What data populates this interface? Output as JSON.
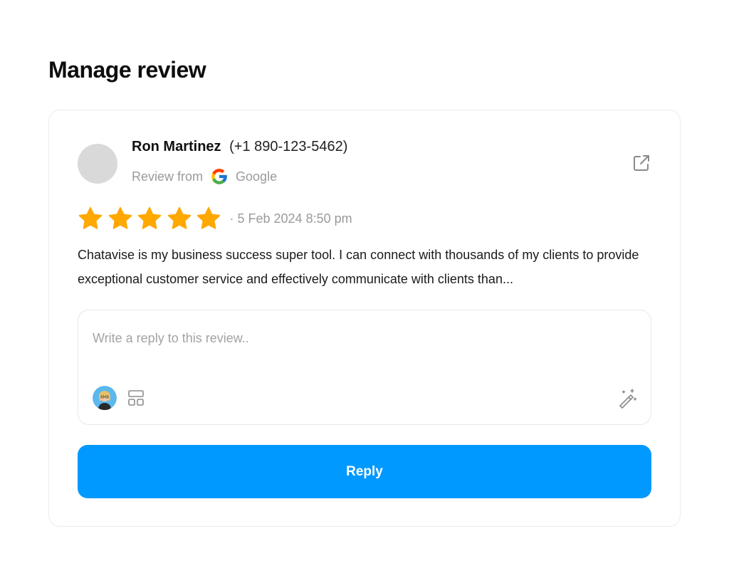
{
  "page": {
    "title": "Manage review"
  },
  "review": {
    "reviewer_name": "Ron Martinez",
    "reviewer_phone": "(+1 890-123-5462)",
    "source_prefix": "Review from",
    "source_name": "Google",
    "rating": 5,
    "rating_max": 5,
    "date": "· 5 Feb 2024 8:50 pm",
    "text": "Chatavise is my business success super tool. I can connect with thousands of my clients to provide exceptional customer service and effectively communicate with clients than..."
  },
  "reply": {
    "placeholder": "Write a reply to this review..",
    "value": "",
    "button_label": "Reply"
  },
  "icons": {
    "external_link": "external-link-icon",
    "source": "google-icon",
    "star": "star-icon",
    "agent": "agent-avatar",
    "templates": "template-icon",
    "ai": "magic-wand-icon"
  },
  "colors": {
    "accent": "#0099ff",
    "star": "#ffa800",
    "muted_text": "#9a9a9a",
    "avatar_placeholder": "#d9d9d9"
  }
}
